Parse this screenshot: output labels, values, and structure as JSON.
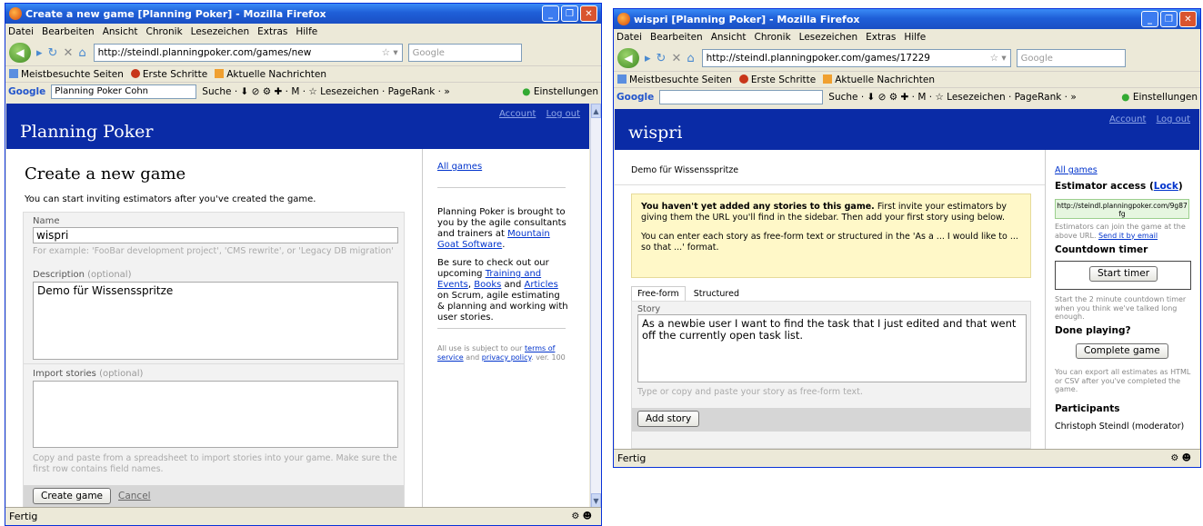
{
  "left_window": {
    "title": "Create a new game [Planning Poker] - Mozilla Firefox",
    "menu": [
      "Datei",
      "Bearbeiten",
      "Ansicht",
      "Chronik",
      "Lesezeichen",
      "Extras",
      "Hilfe"
    ],
    "url": "http://steindl.planningpoker.com/games/new",
    "search_placeholder": "Google",
    "bookmarks": [
      "Meistbesuchte Seiten",
      "Erste Schritte",
      "Aktuelle Nachrichten"
    ],
    "google_label": "Google",
    "google_query": "Planning Poker Cohn",
    "google_tools": "Suche · ⬇ ⊘ ⚙ ✚ · M · ☆ Lesezeichen · PageRank · »",
    "settings": "Einstellungen",
    "status": "Fertig",
    "page": {
      "brand": "Planning Poker",
      "account": "Account",
      "logout": "Log out",
      "heading": "Create a new game",
      "intro": "You can start inviting estimators after you've created the game.",
      "name_label": "Name",
      "name_value": "wispri",
      "name_hint": "For example: 'FooBar development project', 'CMS rewrite', or 'Legacy DB migration'",
      "desc_label": "Description",
      "optional": "(optional)",
      "desc_value": "Demo für Wissensspritze",
      "import_label": "Import stories",
      "import_hint": "Copy and paste from a spreadsheet to import stories into your game. Make sure the first row contains field names.",
      "create_button": "Create game",
      "cancel": "Cancel",
      "sidebar": {
        "all_games": "All games",
        "p1_pre": "Planning Poker is brought to you by the agile consultants and trainers at ",
        "p1_link": "Mountain Goat Software",
        "p1_post": ".",
        "p2_pre": "Be sure to check out our upcoming ",
        "p2_link1": "Training and Events",
        "p2_sep1": ", ",
        "p2_link2": "Books",
        "p2_sep2": " and ",
        "p2_link3": "Articles",
        "p2_post": " on Scrum, agile estimating & planning and working with user stories.",
        "legal_pre": "All use is subject to our ",
        "legal_terms": "terms of service",
        "legal_and": " and ",
        "legal_privacy": "privacy policy",
        "legal_ver": ". ver. 100"
      }
    }
  },
  "right_window": {
    "title": "wispri [Planning Poker] - Mozilla Firefox",
    "menu": [
      "Datei",
      "Bearbeiten",
      "Ansicht",
      "Chronik",
      "Lesezeichen",
      "Extras",
      "Hilfe"
    ],
    "url": "http://steindl.planningpoker.com/games/17229",
    "search_placeholder": "Google",
    "bookmarks": [
      "Meistbesuchte Seiten",
      "Erste Schritte",
      "Aktuelle Nachrichten"
    ],
    "google_label": "Google",
    "google_tools": "Suche · ⬇ ⊘ ⚙ ✚ · M · ☆ Lesezeichen · PageRank · »",
    "settings": "Einstellungen",
    "status": "Fertig",
    "page": {
      "brand": "wispri",
      "account": "Account",
      "logout": "Log out",
      "description": "Demo für Wissensspritze",
      "notice_bold": "You haven't yet added any stories to this game.",
      "notice_rest": " First invite your estimators by giving them the URL you'll find in the sidebar. Then add your first story using below.",
      "notice_2": "You can enter each story as free-form text or structured in the 'As a ... I would like to ... so that ...' format.",
      "tab_free": "Free-form",
      "tab_structured": "Structured",
      "story_label": "Story",
      "story_value": "As a newbie user I want to find the task that I just edited and that went off the currently open task list.",
      "story_hint": "Type or copy and paste your story as free-form text.",
      "add_story": "Add story",
      "sidebar": {
        "all_games": "All games",
        "estimator_access": "Estimator access",
        "lock": "Lock",
        "access_url": "http://steindl.planningpoker.com/9g87fg",
        "access_note_pre": "Estimators can join the game at the above URL. ",
        "send_email": "Send it by email",
        "countdown": "Countdown timer",
        "start_timer": "Start timer",
        "timer_note": "Start the 2 minute countdown timer when you think we've talked long enough.",
        "done": "Done playing?",
        "complete": "Complete game",
        "export_note": "You can export all estimates as HTML or CSV after you've completed the game.",
        "participants": "Participants",
        "participant": "Christoph Steindl (moderator)"
      }
    }
  }
}
